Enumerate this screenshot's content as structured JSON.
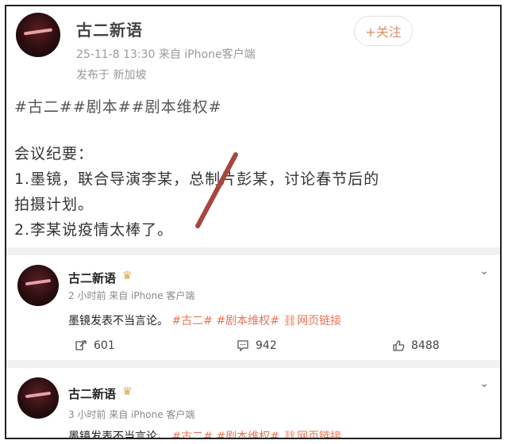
{
  "top_post": {
    "author": "古二新语",
    "meta_time_source": "25-11-8 13:30  来自 iPhone客户端",
    "meta_location": "发布于 新加坡",
    "follow_label": "+关注",
    "hashtags": "#古二##剧本##剧本维权#",
    "lines": [
      "会议纪要：",
      "1.墨镜，联合导演李某，总制片彭某，讨论春节后的",
      "拍摄计划。",
      "2.李某说疫情太棒了。"
    ]
  },
  "posts": [
    {
      "author": "古二新语",
      "meta": "2 小时前  来自 iPhone 客户端",
      "text_prefix": "墨镜发表不当言论。",
      "tags": [
        "#古二#",
        "#剧本维权#"
      ],
      "link_label": "网页链接",
      "reposts": "601",
      "comments": "942",
      "likes": "8488"
    },
    {
      "author": "古二新语",
      "meta": "3 小时前  来自 iPhone 客户端",
      "text_prefix": "墨镜发表不当言论。",
      "tags": [
        "#古二#",
        "#剧本维权#"
      ],
      "link_label": "网页链接"
    }
  ],
  "colors": {
    "tag": "#eb7350",
    "follow_text": "#d4906c",
    "strike": "#a5473c"
  }
}
